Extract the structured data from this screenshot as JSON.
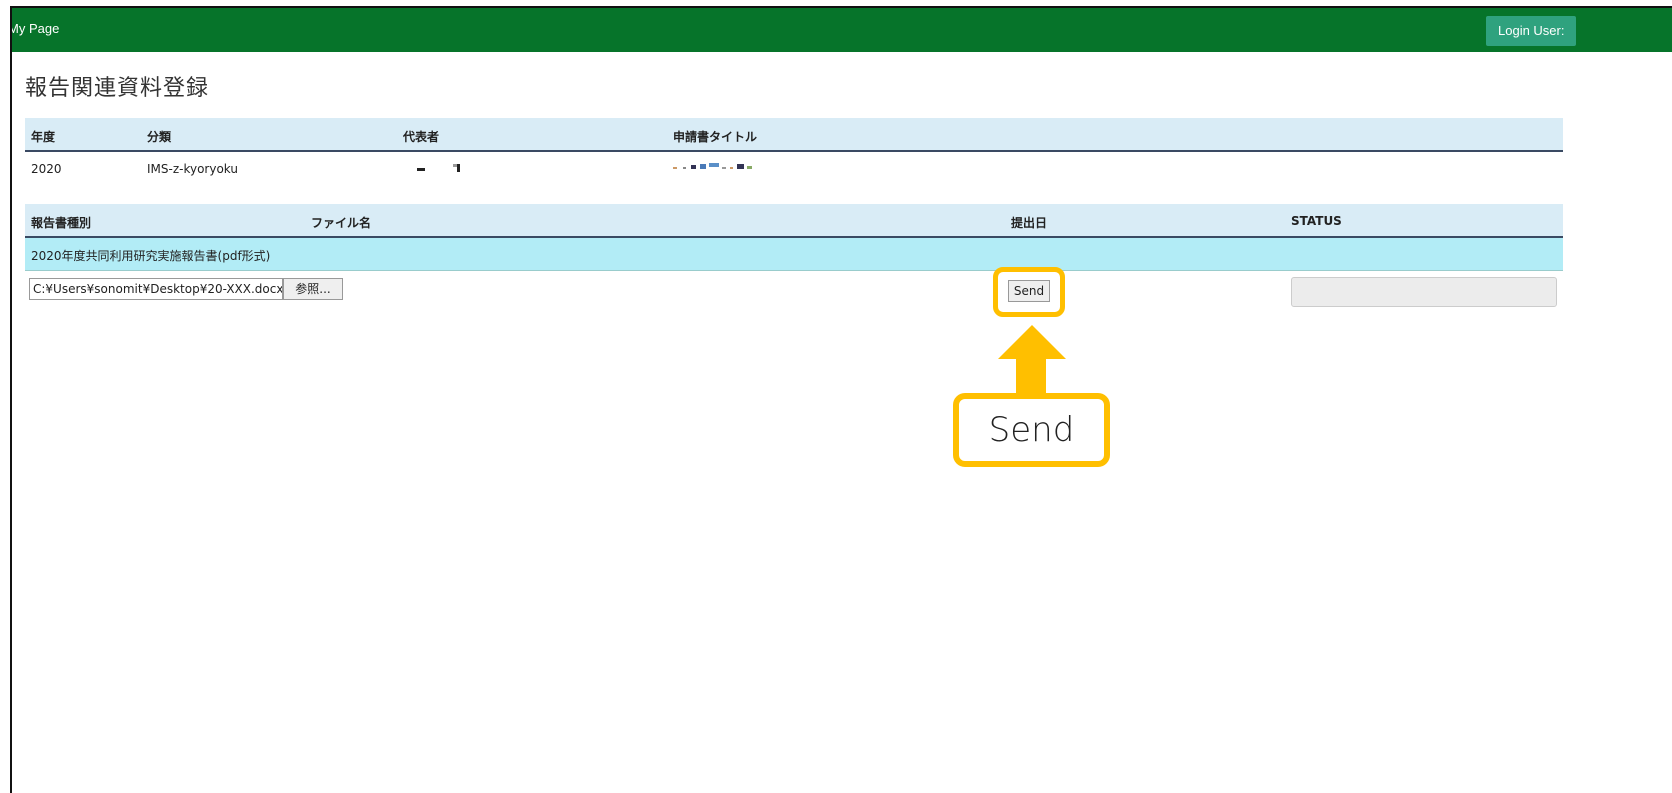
{
  "header": {
    "brand": "My Page",
    "login_label": "Login User:"
  },
  "page": {
    "title": "報告関連資料登録"
  },
  "project_table": {
    "headers": [
      "年度",
      "分類",
      "代表者",
      "申請書タイトル"
    ],
    "row": {
      "year": "2020",
      "category": "IMS-z-kyoryoku"
    }
  },
  "report_table": {
    "headers": [
      "報告書種別",
      "ファイル名",
      "提出日",
      "STATUS"
    ],
    "section_label": "2020年度共同利用研究実施報告書(pdf形式)",
    "file_value": "C:¥Users¥sonomit¥Desktop¥20-XXX.docx",
    "browse_label": "参照...",
    "send_label": "Send",
    "status_value": ""
  },
  "annotation": {
    "callout_text": "Send",
    "highlight_color": "#ffbf00"
  },
  "colors": {
    "topbar": "#06742a",
    "login_button": "#2fa27e",
    "table_header": "#d9ecf6",
    "section_row": "#b2ecf6"
  }
}
